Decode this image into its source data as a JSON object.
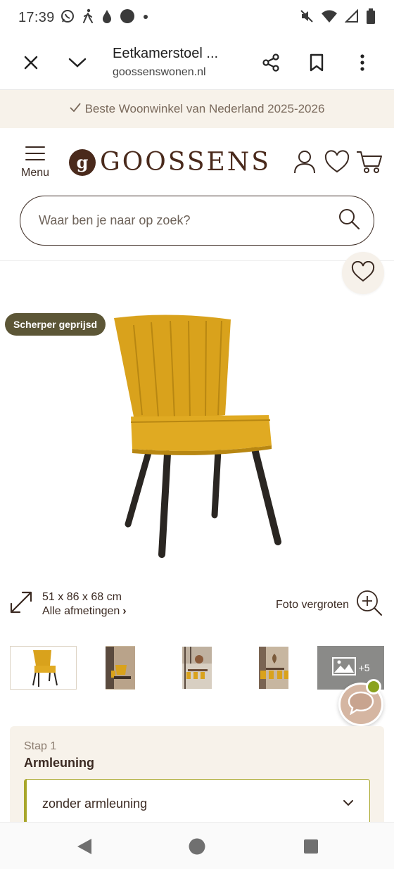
{
  "status_bar": {
    "time": "17:39",
    "left_icons": [
      "whatsapp-icon",
      "walking-icon",
      "drop-icon",
      "circle-icon",
      "dot-icon"
    ],
    "right_icons": [
      "mute-icon",
      "wifi-icon",
      "signal-icon",
      "battery-icon"
    ]
  },
  "toolbar": {
    "title": "Eetkamerstoel ...",
    "url": "goossenswonen.nl"
  },
  "promo": {
    "text": "Beste Woonwinkel van Nederland 2025-2026"
  },
  "header": {
    "menu_label": "Menu",
    "logo_mark": "g",
    "logo_text": "GOOSSENS"
  },
  "search": {
    "placeholder": "Waar ben je naar op zoek?"
  },
  "product": {
    "badge": "Scherper geprijsd",
    "dimensions": "51 x 86 x 68 cm",
    "dimensions_link": "Alle afmetingen",
    "zoom_label": "Foto vergroten",
    "more_photos": "+5",
    "chair_color": "#d9a21c",
    "leg_color": "#2a2622"
  },
  "step": {
    "label": "Stap 1",
    "title": "Armleuning",
    "selected": "zonder armleuning"
  },
  "colors": {
    "brand_brown": "#4a2a1c",
    "badge_olive": "#5c5636",
    "accent_green": "#a8a62a",
    "cream": "#f7f2ea"
  }
}
